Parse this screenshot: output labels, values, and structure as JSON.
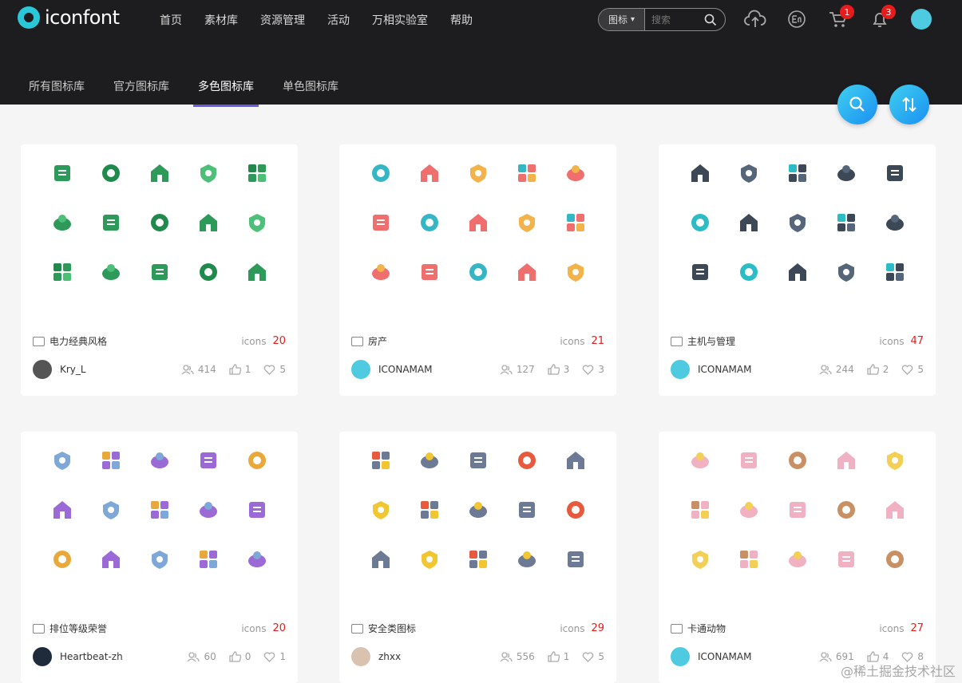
{
  "app": {
    "name": "iconfont"
  },
  "nav": [
    "首页",
    "素材库",
    "资源管理",
    "活动",
    "万相实验室",
    "帮助"
  ],
  "search": {
    "type": "图标",
    "placeholder": "搜索"
  },
  "badges": {
    "cart": "1",
    "bell": "3"
  },
  "tabs": [
    {
      "label": "所有图标库",
      "active": false
    },
    {
      "label": "官方图标库",
      "active": false
    },
    {
      "label": "多色图标库",
      "active": true
    },
    {
      "label": "单色图标库",
      "active": false
    }
  ],
  "icons_label": "icons",
  "cards": [
    {
      "title": "电力经典风格",
      "count": "20",
      "author": "Kry_L",
      "followers": "414",
      "likes": "1",
      "favs": "5",
      "avatar_color": "#555555",
      "palette": [
        "#2e9a5a",
        "#1f8a4c",
        "#4cbf78"
      ]
    },
    {
      "title": "房产",
      "count": "21",
      "author": "ICONAMAM",
      "followers": "127",
      "likes": "3",
      "favs": "3",
      "avatar_color": "#4ecbe0",
      "palette": [
        "#ef6e6e",
        "#35b6c4",
        "#f3b24a"
      ]
    },
    {
      "title": "主机与管理",
      "count": "47",
      "author": "ICONAMAM",
      "followers": "244",
      "likes": "2",
      "favs": "5",
      "avatar_color": "#4ecbe0",
      "palette": [
        "#3d4856",
        "#2bbcc5",
        "#55657a"
      ]
    },
    {
      "title": "排位等级荣誉",
      "count": "20",
      "author": "Heartbeat-zh",
      "followers": "60",
      "likes": "0",
      "favs": "1",
      "avatar_color": "#1f2a3a",
      "palette": [
        "#9b6ad6",
        "#e9a93a",
        "#7ea8d8"
      ]
    },
    {
      "title": "安全类图标",
      "count": "29",
      "author": "zhxx",
      "followers": "556",
      "likes": "1",
      "favs": "5",
      "avatar_color": "#d9c3b0",
      "palette": [
        "#6d7a95",
        "#e85a3e",
        "#f2c630"
      ]
    },
    {
      "title": "卡通动物",
      "count": "27",
      "author": "ICONAMAM",
      "followers": "691",
      "likes": "4",
      "favs": "8",
      "avatar_color": "#4ecbe0",
      "palette": [
        "#f0b2c2",
        "#c99063",
        "#f4cf55"
      ]
    }
  ],
  "watermark": "@稀土掘金技术社区"
}
